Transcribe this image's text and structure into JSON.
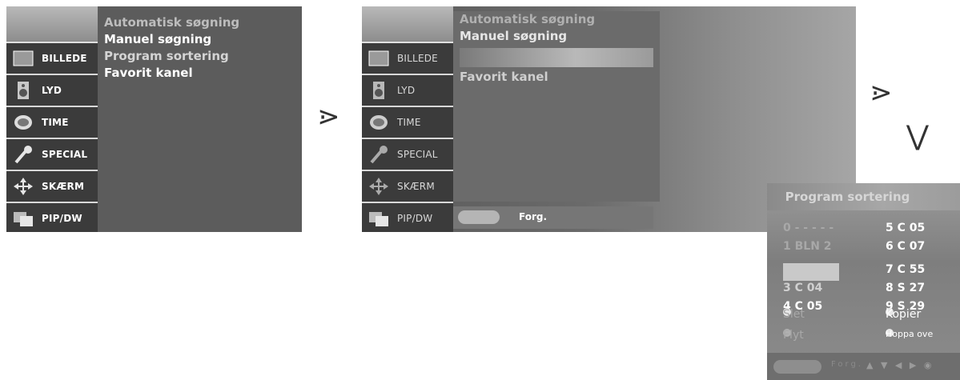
{
  "sidebar": {
    "items": [
      {
        "label": "BILLEDE",
        "icon": "picture-icon"
      },
      {
        "label": "LYD",
        "icon": "speaker-icon"
      },
      {
        "label": "TIME",
        "icon": "clock-icon"
      },
      {
        "label": "SPECIAL",
        "icon": "key-icon"
      },
      {
        "label": "SKÆRM",
        "icon": "cross-arrows-icon"
      },
      {
        "label": "PIP/DW",
        "icon": "pip-icon"
      }
    ]
  },
  "menu1": {
    "items": [
      "Automatisk søgning",
      "Manuel søgning",
      "Program sortering",
      "Favorit kanel"
    ]
  },
  "menu2": {
    "items": [
      "Automatisk søgning",
      "Manuel søgning",
      "Favorit kanel"
    ],
    "footer_label": "Forg."
  },
  "arrows": {
    "right1": "⋗",
    "right2": "⋗",
    "down": "⋁"
  },
  "program_sort": {
    "title": "Program sortering",
    "left": [
      "0 - - - - -",
      "1 BLN 2",
      "",
      "3  C  04",
      "4  C  05"
    ],
    "right": [
      "5  C  05",
      "6  C  07",
      "7  C  55",
      "8  S  27",
      "9  S  29"
    ],
    "actions": {
      "delete": "Slet",
      "copy": "Kopier",
      "move": "Flyt",
      "skip": "Hoppa ove"
    },
    "footer_label": "Forg."
  }
}
